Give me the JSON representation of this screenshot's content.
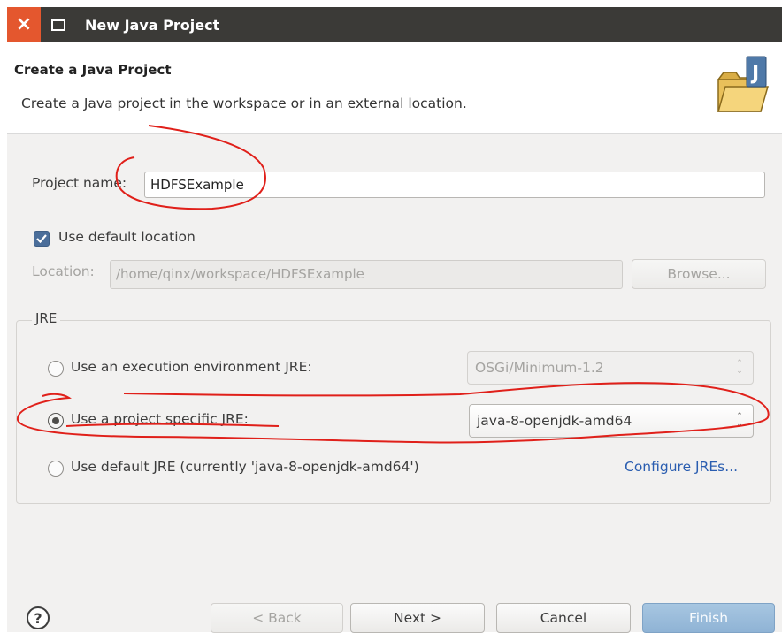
{
  "window": {
    "title": "New Java Project",
    "close_icon": "×",
    "maximize_icon": "maximize-icon"
  },
  "header": {
    "title": "Create a Java Project",
    "description": "Create a Java project in the workspace or in an external location.",
    "icon": "java-project-folder-icon"
  },
  "form": {
    "project_name_label": "Project name:",
    "project_name_value": "HDFSExample",
    "use_default_location_label": "Use default location",
    "use_default_location_checked": true,
    "location_label": "Location:",
    "location_value": "/home/qinx/workspace/HDFSExample",
    "browse_label": "Browse..."
  },
  "jre": {
    "group_title": "JRE",
    "options": [
      {
        "label": "Use an execution environment JRE:",
        "selected": false
      },
      {
        "label": "Use a project specific JRE:",
        "selected": true
      },
      {
        "label": "Use default JRE (currently 'java-8-openjdk-amd64')",
        "selected": false
      }
    ],
    "execution_env_value": "OSGi/Minimum-1.2",
    "project_jre_value": "java-8-openjdk-amd64",
    "configure_link": "Configure JREs...",
    "spinner_up": "⌃",
    "spinner_down": "⌄"
  },
  "footer": {
    "help_icon": "?",
    "back_label": "< Back",
    "next_label": "Next >",
    "cancel_label": "Cancel",
    "finish_label": "Finish"
  },
  "colors": {
    "titlebar": "#3b3a37",
    "close": "#e4572e",
    "annotation": "#e0201a",
    "link": "#2a5db0",
    "finish": "#8fb3d5"
  }
}
